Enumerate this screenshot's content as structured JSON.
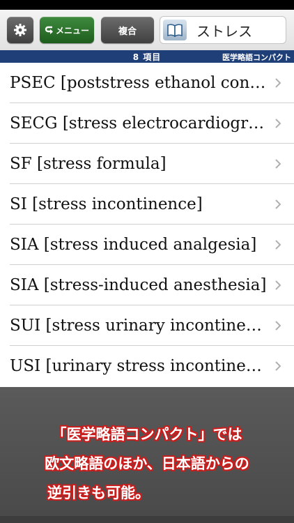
{
  "toolbar": {
    "settings_icon": "gear-icon",
    "menu_icon": "back-arrow-icon",
    "menu_label": "メニュー",
    "combined_label": "複合",
    "search_icon": "book-icon",
    "search_value": "ストレス"
  },
  "info_bar": {
    "count_label": "8 項目",
    "dictionary_name": "医学略語コンパクト"
  },
  "results": [
    "PSEC [poststress ethanol consu...",
    "SECG [stress electrocardiograp...",
    "SF [stress formula]",
    "SI [stress incontinence]",
    "SIA [stress induced analgesia]",
    "SIA [stress-induced anesthesia]",
    "SUI [stress urinary incontinenc...",
    "USI [urinary stress incontinenc..."
  ],
  "promo": {
    "line1": "「医学略語コンパクト」では",
    "line2": "欧文略語のほか、日本語からの",
    "line3": "逆引きも可能。"
  },
  "colors": {
    "info_bar": "#1f3f78",
    "menu_button": "#2c6f2c",
    "promo_outline": "#c81e1e"
  }
}
